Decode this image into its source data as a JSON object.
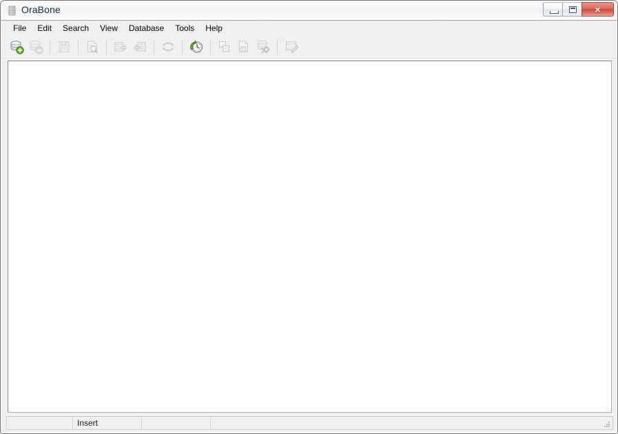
{
  "window": {
    "title": "OraBone",
    "app_icon": "database-server-icon",
    "controls": {
      "minimize": {
        "name": "minimize-button",
        "glyph": "minimize-icon"
      },
      "maximize": {
        "name": "maximize-restore-button",
        "glyph": "restore-icon"
      },
      "close": {
        "name": "close-button",
        "glyph": "×",
        "color": "#cf4a38"
      }
    }
  },
  "menubar": {
    "items": [
      {
        "label": "File"
      },
      {
        "label": "Edit"
      },
      {
        "label": "Search"
      },
      {
        "label": "View"
      },
      {
        "label": "Database"
      },
      {
        "label": "Tools"
      },
      {
        "label": "Help"
      }
    ]
  },
  "toolbar": {
    "buttons": [
      {
        "name": "add-database-button",
        "icon": "database-add-icon",
        "enabled": true
      },
      {
        "name": "remove-database-button",
        "icon": "database-remove-icon",
        "enabled": false
      },
      {
        "separator_after": true
      },
      {
        "name": "save-button",
        "icon": "save-disk-icon",
        "enabled": false
      },
      {
        "separator_after": true
      },
      {
        "name": "find-button",
        "icon": "document-search-icon",
        "enabled": false
      },
      {
        "separator_after": true
      },
      {
        "name": "export-button",
        "icon": "table-export-icon",
        "enabled": false
      },
      {
        "name": "import-button",
        "icon": "table-import-icon",
        "enabled": false
      },
      {
        "separator_after": true
      },
      {
        "name": "refresh-sync-button",
        "icon": "sync-arrows-icon",
        "enabled": false
      },
      {
        "separator_after": true
      },
      {
        "name": "history-button",
        "icon": "clock-history-icon",
        "enabled": true
      },
      {
        "separator_after": true
      },
      {
        "name": "copy-button",
        "icon": "copy-icon",
        "enabled": false
      },
      {
        "name": "paste-button",
        "icon": "paste-document-icon",
        "enabled": false
      },
      {
        "name": "database-settings-button",
        "icon": "database-gear-icon",
        "enabled": false
      },
      {
        "separator_after": true
      },
      {
        "name": "edit-document-button",
        "icon": "document-edit-icon",
        "enabled": false
      }
    ]
  },
  "client": {
    "content": ""
  },
  "statusbar": {
    "panels": [
      {
        "name": "status-panel-position",
        "text": ""
      },
      {
        "name": "status-panel-insert-mode",
        "text": "Insert"
      },
      {
        "name": "status-panel-modified",
        "text": ""
      },
      {
        "name": "status-panel-message",
        "text": ""
      }
    ],
    "resize_grip": "resize-grip-icon"
  }
}
